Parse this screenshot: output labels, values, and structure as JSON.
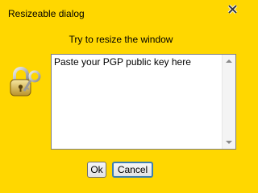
{
  "window": {
    "title": "Resizeable dialog",
    "close_icon": "close-icon",
    "background": "#ffd700"
  },
  "dialog": {
    "prompt": "Try to resize the window",
    "icon": "padlock-key-icon",
    "textarea": {
      "value": "Paste your PGP public key here",
      "scrollbar_up_icon": "scroll-up-arrow-icon",
      "scrollbar_down_icon": "scroll-down-arrow-icon"
    }
  },
  "buttons": {
    "ok_label": "Ok",
    "cancel_label": "Cancel",
    "focused": "cancel",
    "focus_color": "#3c7fb1"
  }
}
